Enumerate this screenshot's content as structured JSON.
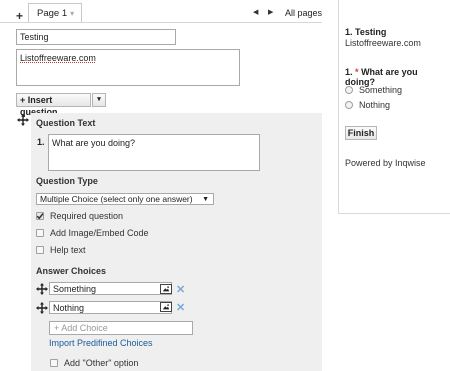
{
  "tabs": {
    "add_label": "+",
    "page_tab": "Page 1",
    "tab_chevron": "▾",
    "prev": "◀",
    "next": "▶",
    "all_pages": "All pages"
  },
  "page": {
    "title_value": "Testing",
    "description_value": "Listoffreeware.com"
  },
  "insert": {
    "label": "+ Insert question",
    "arrow": "▾"
  },
  "question": {
    "text_label": "Question Text",
    "number": "1.",
    "text_value": "What are you doing?",
    "type_label": "Question Type",
    "type_value": "Multiple Choice (select only one answer)",
    "type_arrow": "▼",
    "options": [
      {
        "label": "Required question",
        "checked": true
      },
      {
        "label": "Add Image/Embed Code",
        "checked": false
      },
      {
        "label": "Help text",
        "checked": false
      }
    ],
    "answers_label": "Answer Choices",
    "answers": [
      "Something",
      "Nothing"
    ],
    "remove_glyph": "✕",
    "add_choice_placeholder": "+ Add Choice",
    "import_link": "Import Predifined Choices",
    "other_option": "Add \"Other\" option"
  },
  "preview": {
    "page_title": "1. Testing",
    "page_sub": "Listoffreeware.com",
    "question_number": "1.",
    "required_mark": "*",
    "question_text": "What are you doing?",
    "answers": [
      "Something",
      "Nothing"
    ],
    "finish_label": "Finish",
    "powered_by": "Powered by Inqwise"
  },
  "icons": {
    "move": "move-icon",
    "image": "image-icon",
    "checkmark": "check-icon"
  }
}
